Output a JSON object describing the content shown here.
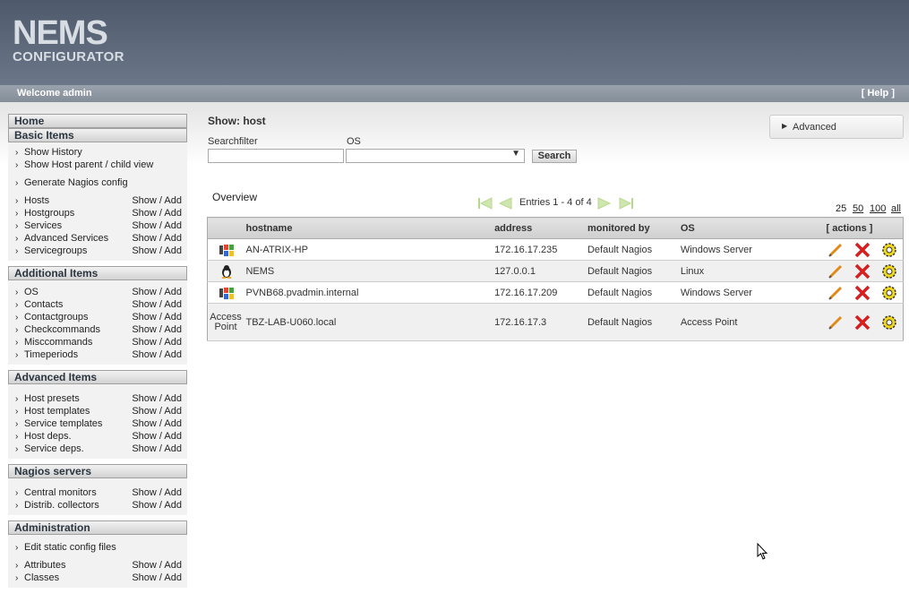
{
  "header": {
    "logo_line1": "NEMS",
    "logo_line2": "CONFIGURATOR",
    "welcome": "Welcome admin",
    "help": "[ Help ]"
  },
  "sidebar": {
    "home": "Home",
    "basic": {
      "title": "Basic Items",
      "show_history": "Show History",
      "show_host_parent": "Show Host parent / child view",
      "generate": "Generate Nagios config",
      "items": [
        {
          "label": "Hosts",
          "sa": "Show / Add"
        },
        {
          "label": "Hostgroups",
          "sa": "Show / Add"
        },
        {
          "label": "Services",
          "sa": "Show / Add"
        },
        {
          "label": "Advanced Services",
          "sa": "Show / Add"
        },
        {
          "label": "Servicegroups",
          "sa": "Show / Add"
        }
      ]
    },
    "additional": {
      "title": "Additional Items",
      "items": [
        {
          "label": "OS",
          "sa": "Show / Add"
        },
        {
          "label": "Contacts",
          "sa": "Show / Add"
        },
        {
          "label": "Contactgroups",
          "sa": "Show / Add"
        },
        {
          "label": "Checkcommands",
          "sa": "Show / Add"
        },
        {
          "label": "Misccommands",
          "sa": "Show / Add"
        },
        {
          "label": "Timeperiods",
          "sa": "Show / Add"
        }
      ]
    },
    "advanced": {
      "title": "Advanced Items",
      "items": [
        {
          "label": "Host presets",
          "sa": "Show / Add"
        },
        {
          "label": "Host templates",
          "sa": "Show / Add"
        },
        {
          "label": "Service templates",
          "sa": "Show / Add"
        },
        {
          "label": "Host deps.",
          "sa": "Show / Add"
        },
        {
          "label": "Service deps.",
          "sa": "Show / Add"
        }
      ]
    },
    "nagios": {
      "title": "Nagios servers",
      "items": [
        {
          "label": "Central monitors",
          "sa": "Show / Add"
        },
        {
          "label": "Distrib. collectors",
          "sa": "Show / Add"
        }
      ]
    },
    "admin": {
      "title": "Administration",
      "edit_static": "Edit static config files",
      "items": [
        {
          "label": "Attributes",
          "sa": "Show / Add"
        },
        {
          "label": "Classes",
          "sa": "Show / Add"
        }
      ]
    }
  },
  "main": {
    "title": "Show: host",
    "searchfilter_label": "Searchfilter",
    "os_label": "OS",
    "searchfilter_value": "",
    "os_value": "",
    "search_button": "Search",
    "advanced": "Advanced",
    "overview": "Overview",
    "entries": "Entries 1 - 4 of 4",
    "per_page": [
      "25",
      "50",
      "100",
      "all"
    ],
    "columns": {
      "hostname": "hostname",
      "address": "address",
      "monitored_by": "monitored by",
      "os": "OS",
      "actions": "[ actions ]"
    },
    "rows": [
      {
        "icon": "windows-icon",
        "hostname": "AN-ATRIX-HP",
        "address": "172.16.17.235",
        "monitored_by": "Default Nagios",
        "os": "Windows Server"
      },
      {
        "icon": "linux-icon",
        "hostname": "NEMS",
        "address": "127.0.0.1",
        "monitored_by": "Default Nagios",
        "os": "Linux"
      },
      {
        "icon": "windows-icon",
        "hostname": "PVNB68.pvadmin.internal",
        "address": "172.16.17.209",
        "monitored_by": "Default Nagios",
        "os": "Windows Server"
      },
      {
        "icon": "broken-image-icon",
        "icon_alt": "Access Point",
        "hostname": "TBZ-LAB-U060.local",
        "address": "172.16.17.3",
        "monitored_by": "Default Nagios",
        "os": "Access Point"
      }
    ]
  }
}
